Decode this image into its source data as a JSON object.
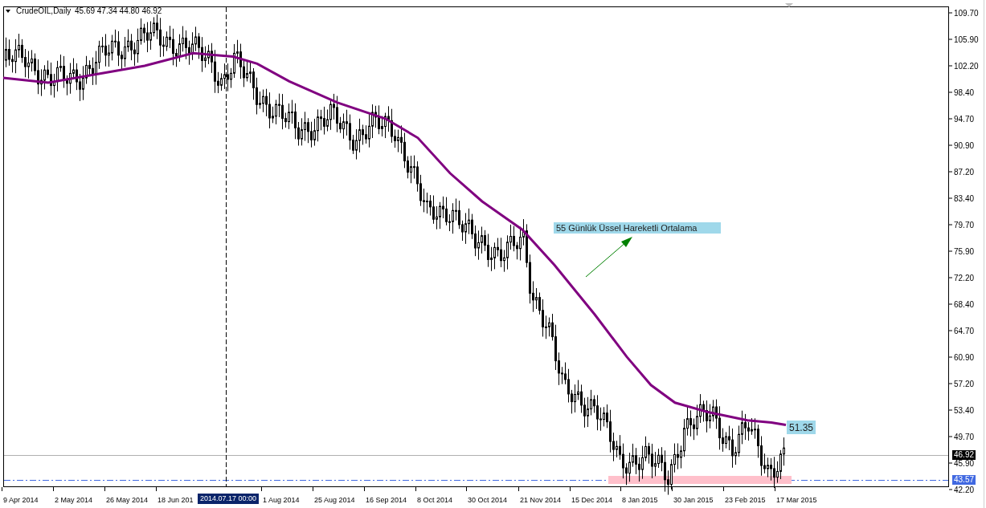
{
  "header": {
    "symbol": "CrudeOIL,Daily",
    "ohlc": "45.69 47.34 44.80 46.92"
  },
  "price_axis": {
    "labels": [
      "109.70",
      "105.90",
      "102.20",
      "98.40",
      "94.70",
      "90.90",
      "87.20",
      "83.40",
      "79.70",
      "75.90",
      "72.20",
      "68.40",
      "64.70",
      "60.90",
      "57.20",
      "53.40",
      "49.70",
      "45.90",
      "42.20"
    ],
    "current_price": "46.92",
    "line_price": "43.57"
  },
  "time_axis": {
    "labels": [
      "9 Apr 2014",
      "2 May 2014",
      "26 May 2014",
      "18 Jun 201",
      "1 Aug 2014",
      "25 Aug 2014",
      "16 Sep 2014",
      "8 Oct 2014",
      "30 Oct 2014",
      "21 Nov 2014",
      "15 Dec 2014",
      "8 Jan 2015",
      "30 Jan 2015",
      "23 Feb 2015",
      "17 Mar 2015"
    ],
    "crosshair_label": "2014.07.17 00:00"
  },
  "annotations": {
    "ema_label": "55 Günlük Üssel Hareketli Ortalama",
    "ema_value": "51.35"
  }
}
